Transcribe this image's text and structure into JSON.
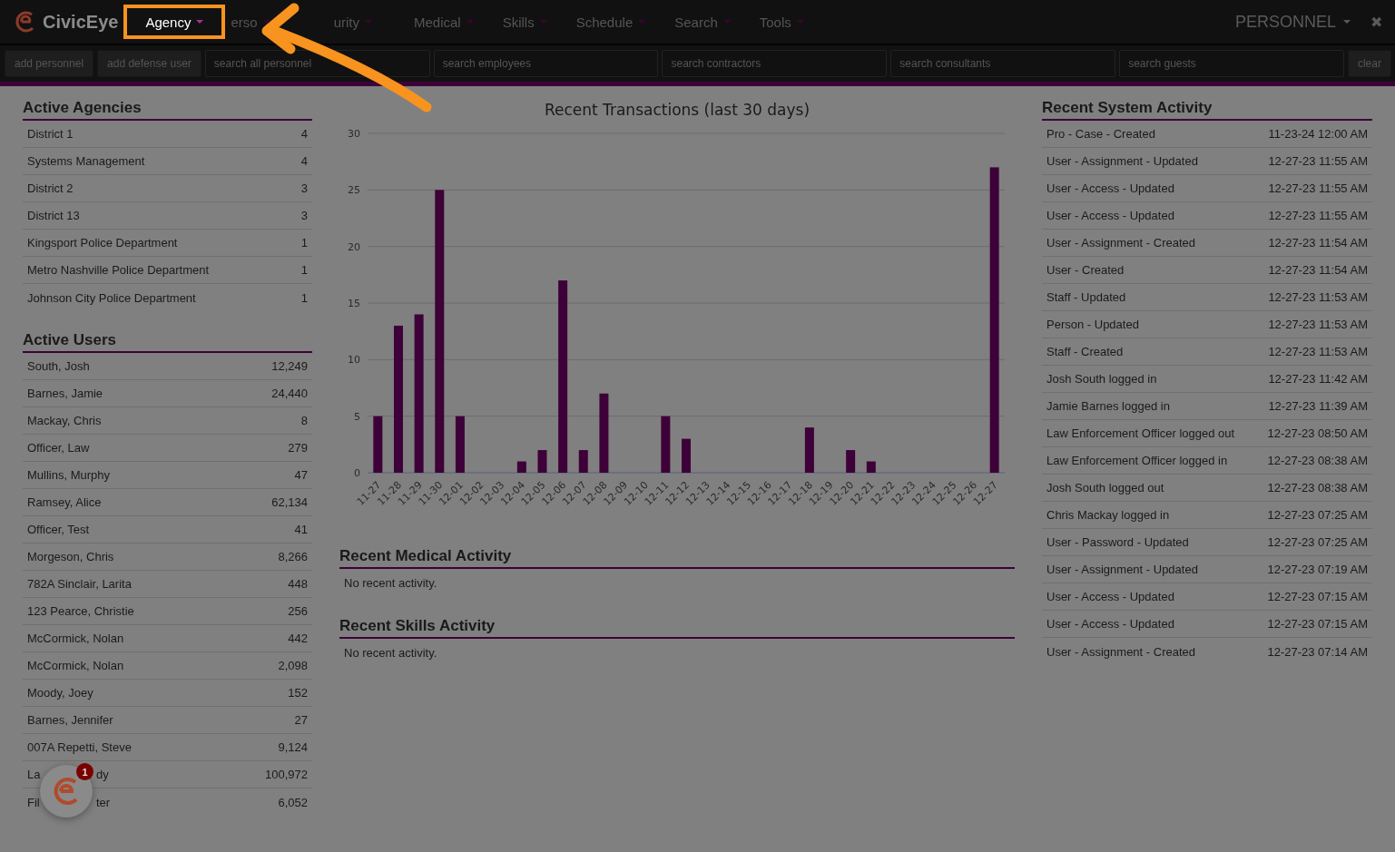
{
  "brand": "CivicEye",
  "nav": [
    {
      "label": "Agency",
      "selected": true
    },
    {
      "label": "erso",
      "selected": false
    },
    {
      "label": "urity",
      "selected": false
    },
    {
      "label": "Medical",
      "selected": false
    },
    {
      "label": "Skills",
      "selected": false
    },
    {
      "label": "Schedule",
      "selected": false
    },
    {
      "label": "Search",
      "selected": false
    },
    {
      "label": "Tools",
      "selected": false
    }
  ],
  "module_menu": "PERSONNEL",
  "close_glyph": "✖",
  "toolbar": [
    {
      "kind": "button",
      "label": "add personnel"
    },
    {
      "kind": "button",
      "label": "add defense user"
    },
    {
      "kind": "search",
      "placeholder": "search all personnel"
    },
    {
      "kind": "search",
      "placeholder": "search employees"
    },
    {
      "kind": "search",
      "placeholder": "search contractors"
    },
    {
      "kind": "search",
      "placeholder": "search consultants"
    },
    {
      "kind": "search",
      "placeholder": "search guests"
    },
    {
      "kind": "button",
      "label": "clear"
    }
  ],
  "active_agencies": {
    "title": "Active Agencies",
    "rows": [
      {
        "name": "District 1",
        "count": "4"
      },
      {
        "name": "Systems Management",
        "count": "4"
      },
      {
        "name": "District 2",
        "count": "3"
      },
      {
        "name": "District 13",
        "count": "3"
      },
      {
        "name": "Kingsport Police Department",
        "count": "1"
      },
      {
        "name": "Metro Nashville Police Department",
        "count": "1"
      },
      {
        "name": "Johnson City Police Department",
        "count": "1"
      }
    ]
  },
  "active_users": {
    "title": "Active Users",
    "rows": [
      {
        "name": "South, Josh",
        "count": "12,249"
      },
      {
        "name": "Barnes, Jamie",
        "count": "24,440"
      },
      {
        "name": "Mackay, Chris",
        "count": "8"
      },
      {
        "name": "Officer, Law",
        "count": "279"
      },
      {
        "name": "Mullins, Murphy",
        "count": "47"
      },
      {
        "name": "Ramsey, Alice",
        "count": "62,134"
      },
      {
        "name": "Officer, Test",
        "count": "41"
      },
      {
        "name": "Morgeson, Chris",
        "count": "8,266"
      },
      {
        "name": "782A Sinclair, Larita",
        "count": "448"
      },
      {
        "name": "123 Pearce, Christie",
        "count": "256"
      },
      {
        "name": "McCormick, Nolan",
        "count": "442"
      },
      {
        "name": "McCormick, Nolan",
        "count": "2,098"
      },
      {
        "name": "Moody, Joey",
        "count": "152"
      },
      {
        "name": "Barnes, Jennifer",
        "count": "27"
      },
      {
        "name": "007A Repetti, Steve",
        "count": "9,124"
      },
      {
        "name": "La",
        "name_tail": "dy",
        "count": "100,972"
      },
      {
        "name": "Fil",
        "name_tail": "ter",
        "count": "6,052"
      }
    ]
  },
  "chart": {
    "chart_data": {
      "type": "bar",
      "title": "Recent Transactions (last 30 days)",
      "categories": [
        "11-27",
        "11-28",
        "11-29",
        "11-30",
        "12-01",
        "12-02",
        "12-03",
        "12-04",
        "12-05",
        "12-06",
        "12-07",
        "12-08",
        "12-09",
        "12-10",
        "12-11",
        "12-12",
        "12-13",
        "12-14",
        "12-15",
        "12-16",
        "12-17",
        "12-18",
        "12-19",
        "12-20",
        "12-21",
        "12-22",
        "12-23",
        "12-24",
        "12-25",
        "12-26",
        "12-27"
      ],
      "grid": true,
      "series": [
        {
          "color": "#3d0038",
          "values": [
            5,
            13,
            14,
            25,
            5,
            0,
            0,
            1,
            2,
            17,
            2,
            7,
            0,
            0,
            5,
            3,
            0,
            0,
            0,
            0,
            0,
            4,
            0,
            2,
            1,
            0,
            0,
            0,
            0,
            0,
            27
          ]
        }
      ],
      "ylim": [
        0,
        30
      ],
      "yticks": [
        0,
        5,
        10,
        15,
        20,
        25,
        30
      ]
    }
  },
  "medical": {
    "title": "Recent Medical Activity",
    "empty": "No recent activity."
  },
  "skills": {
    "title": "Recent Skills Activity",
    "empty": "No recent activity."
  },
  "system_activity": {
    "title": "Recent System Activity",
    "rows": [
      {
        "event": "Pro - Case - Created",
        "time": "11-23-24 12:00 AM"
      },
      {
        "event": "User - Assignment - Updated",
        "time": "12-27-23 11:55 AM"
      },
      {
        "event": "User - Access - Updated",
        "time": "12-27-23 11:55 AM"
      },
      {
        "event": "User - Access - Updated",
        "time": "12-27-23 11:55 AM"
      },
      {
        "event": "User - Assignment - Created",
        "time": "12-27-23 11:54 AM"
      },
      {
        "event": "User - Created",
        "time": "12-27-23 11:54 AM"
      },
      {
        "event": "Staff - Updated",
        "time": "12-27-23 11:53 AM"
      },
      {
        "event": "Person - Updated",
        "time": "12-27-23 11:53 AM"
      },
      {
        "event": "Staff - Created",
        "time": "12-27-23 11:53 AM"
      },
      {
        "event": "Josh South logged in",
        "time": "12-27-23 11:42 AM"
      },
      {
        "event": "Jamie Barnes logged in",
        "time": "12-27-23 11:39 AM"
      },
      {
        "event": "Law Enforcement Officer logged out",
        "time": "12-27-23 08:50 AM"
      },
      {
        "event": "Law Enforcement Officer logged in",
        "time": "12-27-23 08:38 AM"
      },
      {
        "event": "Josh South logged out",
        "time": "12-27-23 08:38 AM"
      },
      {
        "event": "Chris Mackay logged in",
        "time": "12-27-23 07:25 AM"
      },
      {
        "event": "User - Password - Updated",
        "time": "12-27-23 07:25 AM"
      },
      {
        "event": "User - Assignment - Updated",
        "time": "12-27-23 07:19 AM"
      },
      {
        "event": "User - Access - Updated",
        "time": "12-27-23 07:15 AM"
      },
      {
        "event": "User - Access - Updated",
        "time": "12-27-23 07:15 AM"
      },
      {
        "event": "User - Assignment - Created",
        "time": "12-27-23 07:14 AM"
      }
    ]
  },
  "help_badge": "1"
}
